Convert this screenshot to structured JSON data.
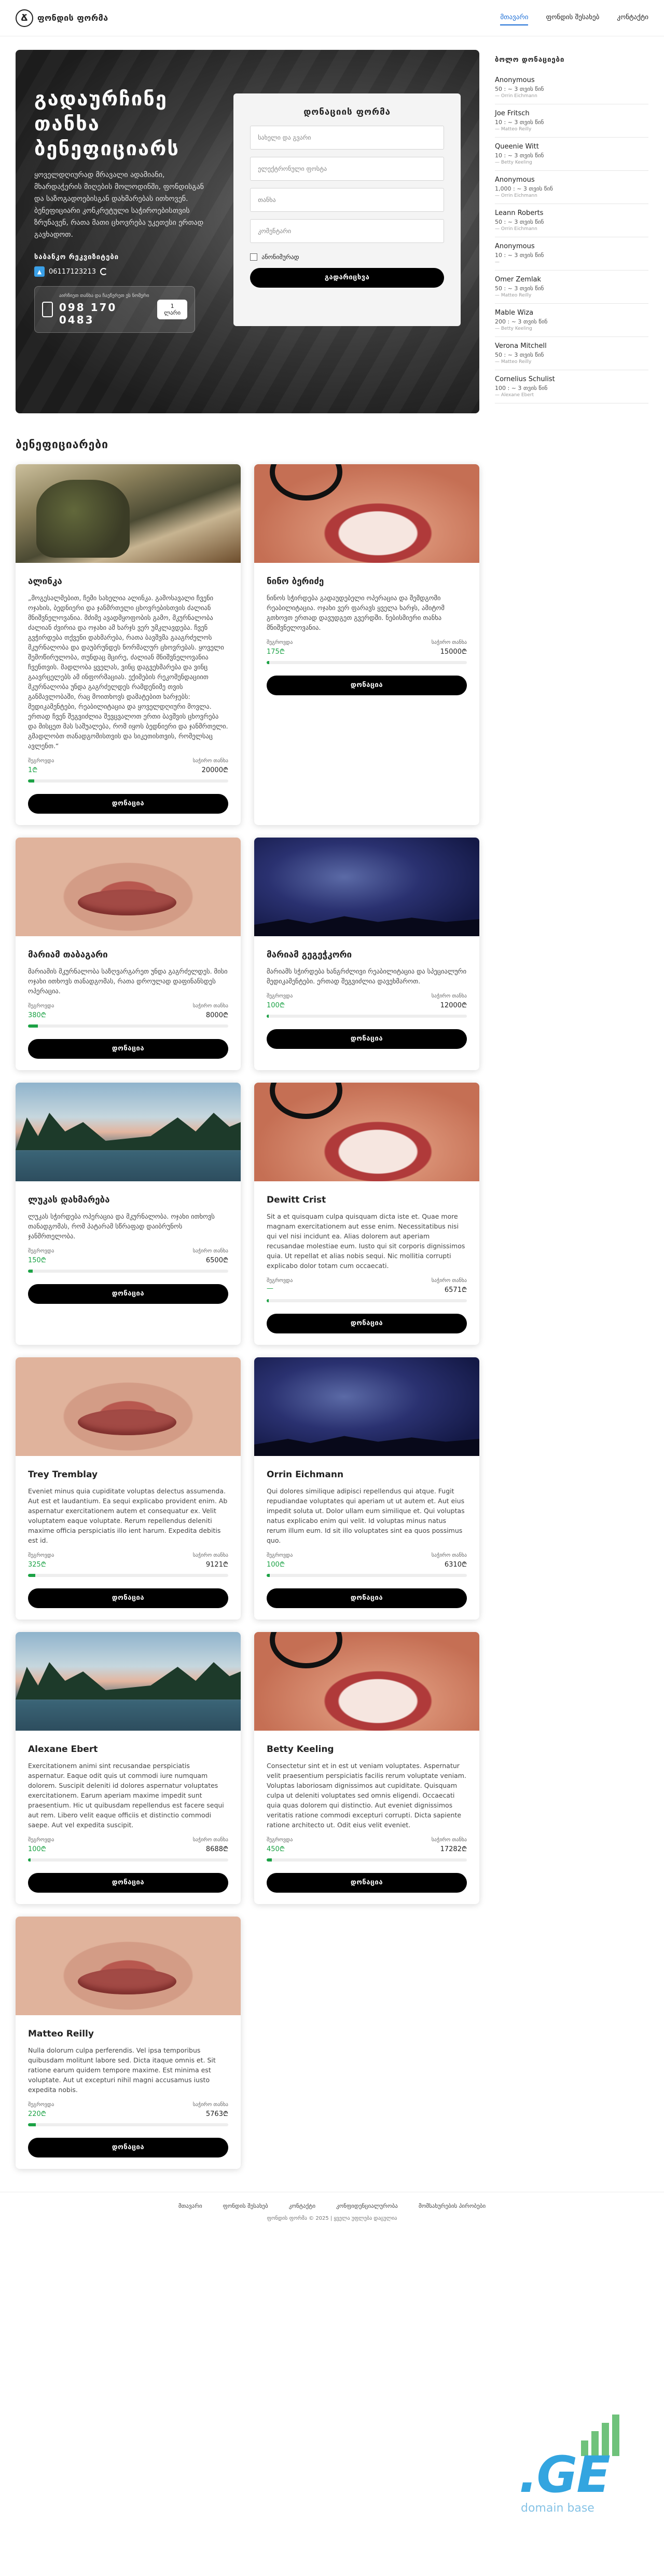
{
  "header": {
    "logo_mark": "Ճ",
    "logo_text": "ფონდის ფორმა",
    "nav": [
      "მთავარი",
      "ფონდის შესახებ",
      "კონტაქტი"
    ]
  },
  "hero": {
    "title": "გადაურჩინე თანხა ბენეფიციარს",
    "text": "ყოველდღიურად მრავალი ადამიანი, მხარდაჭერის მიღების მოლოდინში, ფონდისგან და საზოგადოებისგან დახმარებას ითხოვენ. ბენეფიციარი კონკრეტული საჭიროებისთვის ზრუნავენ, რათა მათი ცხოვრება უკეთესი ერთად გავხადოთ.",
    "bank_title": "საბანკო რეკვიზიტები",
    "bank_account": "06117123213",
    "sms_label": "აირჩიეთ თანხა და ჩაეწერეთ ეს ნომერი",
    "sms_number": "098 170 0483",
    "sms_cost": "1 ლარი"
  },
  "form": {
    "title": "დონაციის ფორმა",
    "fields": [
      "სახელი და გვარი",
      "ელექტრონული ფოსტა",
      "თანხა",
      "კომენტარი"
    ],
    "anonymous_label": "ანონიმურად",
    "submit": "გადარიცხვა"
  },
  "section_title": "ბენეფიციარები",
  "card_labels": {
    "raised": "შეგროვდა",
    "goal": "საჭირო თანხა",
    "button": "დონაცია"
  },
  "cards": [
    {
      "title": "ალინკა",
      "text": "„მოგესალმებით, ჩემი სახელია ალინკა. გამოსავალი ჩვენი ოჯახის, ბედნიერი და ჯანმრთელი ცხოვრებისთვის ძალიან მნიშვნელოვანია. მძიმე ავადმყოფობის გამო, მკურნალობა ძალიან ძვირია და ოჯახი ამ ხარჯს ვერ უმკლავდება. ჩვენ გვჭირდება თქვენი დახმარება, რათა ბავშვმა გააგრძელოს მკურნალობა და დაუბრუნდეს ნორმალურ ცხოვრებას. ყოველი შემოწირულობა, თუნდაც მცირე, ძალიან მნიშვნელოვანია ჩვენთვის. მადლობა ყველას, ვინც დაგვეხმარება და ვინც გაავრცელებს ამ ინფორმაციას. ექიმების რეკომენდაციით მკურნალობა უნდა გაგრძელდეს რამდენიმე თვის განმავლობაში, რაც მოითხოვს დამატებით ხარჯებს: მედიკამენტები, რეაბილიტაცია და ყოველდღიური მოვლა. ერთად ჩვენ შეგვიძლია შევცვალოთ ერთი ბავშვის ცხოვრება და მისცეთ მას საშუალება, რომ იყოს ბედნიერი და ჯანმრთელი. გმადლობთ თანადგომისთვის და სიკეთისთვის, რომელსაც ავლენთ.“",
      "raised": "1₾",
      "goal": "20000₾",
      "percent": 3,
      "img": "img-vr"
    },
    {
      "title": "ნინო ბერიძე",
      "text": "ნინოს სჭირდება გადაუდებელი ოპერაცია და შემდგომი რეაბილიტაცია. ოჯახი ვერ ფარავს ყველა ხარჯს, ამიტომ გთხოვთ ერთად დავუდგეთ გვერდში. ნებისმიერი თანხა მნიშვნელოვანია.",
      "raised": "175₾",
      "goal": "15000₾",
      "percent": 1.2,
      "img": "img-teeth"
    },
    {
      "title": "მარიამ თაბაგარი",
      "text": "მარიამის მკურნალობა საზღვარგარეთ უნდა გაგრძელდეს. მისი ოჯახი ითხოვს თანადგომას, რათა დროულად დაფინანსდეს ოპერაცია.",
      "raised": "380₾",
      "goal": "8000₾",
      "percent": 4.8,
      "img": "img-lips"
    },
    {
      "title": "მარიამ გეგეჭკორი",
      "text": "მარიამს სჭირდება ხანგრძლივი რეაბილიტაცია და სპეციალური მედიკამენტები. ერთად შეგვიძლია დავეხმაროთ.",
      "raised": "100₾",
      "goal": "12000₾",
      "percent": 0.8,
      "img": "img-stars"
    },
    {
      "title": "ლუკას დახმარება",
      "text": "ლუკას სჭირდება ოპერაცია და მკურნალობა. ოჯახი ითხოვს თანადგომას, რომ პატარამ სწრაფად დაიბრუნოს ჯანმრთელობა.",
      "raised": "150₾",
      "goal": "6500₾",
      "percent": 2.3,
      "img": "img-lake"
    },
    {
      "title": "Dewitt Crist",
      "text": "Sit a et quisquam culpa quisquam dicta iste et. Quae more magnam exercitationem aut esse enim. Necessitatibus nisi qui vel nisi incidunt ea. Alias dolorem aut aperiam recusandae molestiae eum. Iusto qui sit corporis dignissimos quia. Ut repellat et alias nobis sequi. Nic mollitia corrupti explicabo dolor totam cum occaecati.",
      "raised": "—",
      "goal": "6571₾",
      "percent": 0,
      "img": "img-teeth"
    },
    {
      "title": "Trey Tremblay",
      "text": "Eveniet minus quia cupiditate voluptas delectus assumenda. Aut est et laudantium. Ea sequi explicabo provident enim. Ab aspernatur exercitationem autem et consequatur ex. Velit voluptatem eaque voluptate. Rerum repellendus deleniti maxime officia perspiciatis illo ient harum. Expedita debitis est id.",
      "raised": "325₾",
      "goal": "9121₾",
      "percent": 3.5,
      "img": "img-lips"
    },
    {
      "title": "Orrin Eichmann",
      "text": "Qui dolores similique adipisci repellendus qui atque. Fugit repudiandae voluptates qui aperiam ut ut autem et. Aut eius impedit soluta ut. Dolor ullam eum similique et. Qui voluptas natus explicabo enim qui velit. Id voluptas minus natus rerum illum eum. Id sit illo voluptates sint ea quos possimus quo.",
      "raised": "100₾",
      "goal": "6310₾",
      "percent": 1.6,
      "img": "img-stars"
    },
    {
      "title": "Alexane Ebert",
      "text": "Exercitationem animi sint recusandae perspiciatis aspernatur. Eaque odit quis ut commodi iure numquam dolorem. Suscipit deleniti id dolores aspernatur voluptates exercitationem. Earum aperiam maxime impedit sunt praesentium. Hic ut quibusdam repellendus est facere sequi aut rem. Libero velit eaque officiis et distinctio commodi saepe. Aut vel expedita suscipit.",
      "raised": "100₾",
      "goal": "8688₾",
      "percent": 1.2,
      "img": "img-lake"
    },
    {
      "title": "Betty Keeling",
      "text": "Consectetur sint et in est ut veniam voluptates. Aspernatur velit praesentium perspiciatis facilis rerum voluptate veniam. Voluptas laboriosam dignissimos aut cupiditate. Quisquam culpa ut deleniti voluptates sed omnis eligendi. Occaecati quia quas dolorem qui distinctio. Aut eveniet dignissimos veritatis ratione commodi excepturi corrupti. Dicta sapiente ratione architecto ut. Odit eius velit eveniet.",
      "raised": "450₾",
      "goal": "17282₾",
      "percent": 2.6,
      "img": "img-teeth"
    },
    {
      "title": "Matteo Reilly",
      "text": "Nulla dolorum culpa perferendis. Vel ipsa temporibus quibusdam molitunt labore sed. Dicta itaque omnis et. Sit ratione earum quidem tempore maxime. Est minima est voluptate. Aut ut excepturi nihil magni accusamus iusto expedita nobis.",
      "raised": "220₾",
      "goal": "5763₾",
      "percent": 3.8,
      "img": "img-lips"
    }
  ],
  "sidebar": {
    "title": "ბოლო დონაციები",
    "donors": [
      {
        "name": "Anonymous",
        "amount": "50 : ~ 3 თვის წინ",
        "cause": "— Orrin Eichmann"
      },
      {
        "name": "Joe Fritsch",
        "amount": "10 : ~ 3 თვის წინ",
        "cause": "— Matteo Reilly"
      },
      {
        "name": "Queenie Witt",
        "amount": "10 : ~ 3 თვის წინ",
        "cause": "— Betty Keeling"
      },
      {
        "name": "Anonymous",
        "amount": "1,000 : ~ 3 თვის წინ",
        "cause": "— Orrin Eichmann"
      },
      {
        "name": "Leann Roberts",
        "amount": "50 : ~ 3 თვის წინ",
        "cause": "— Orrin Eichmann"
      },
      {
        "name": "Anonymous",
        "amount": "10 : ~ 3 თვის წინ",
        "cause": "—"
      },
      {
        "name": "Omer Zemlak",
        "amount": "50 : ~ 3 თვის წინ",
        "cause": "— Matteo Reilly"
      },
      {
        "name": "Mable Wiza",
        "amount": "200 : ~ 3 თვის წინ",
        "cause": "— Betty Keeling"
      },
      {
        "name": "Verona Mitchell",
        "amount": "50 : ~ 3 თვის წინ",
        "cause": "— Matteo Reilly"
      },
      {
        "name": "Cornelius Schulist",
        "amount": "100 : ~ 3 თვის წინ",
        "cause": "— Alexane Ebert"
      }
    ]
  },
  "footer": {
    "links": [
      "მთავარი",
      "ფონდის შესახებ",
      "კონტაქტი",
      "კონფიდენციალურობა",
      "მომსახურების პირობები"
    ],
    "copyright": "ფონდის ფორმა © 2025 | ყველა უფლება დაცულია"
  },
  "badge": {
    "ge": ".GE",
    "sub": "domain base"
  }
}
